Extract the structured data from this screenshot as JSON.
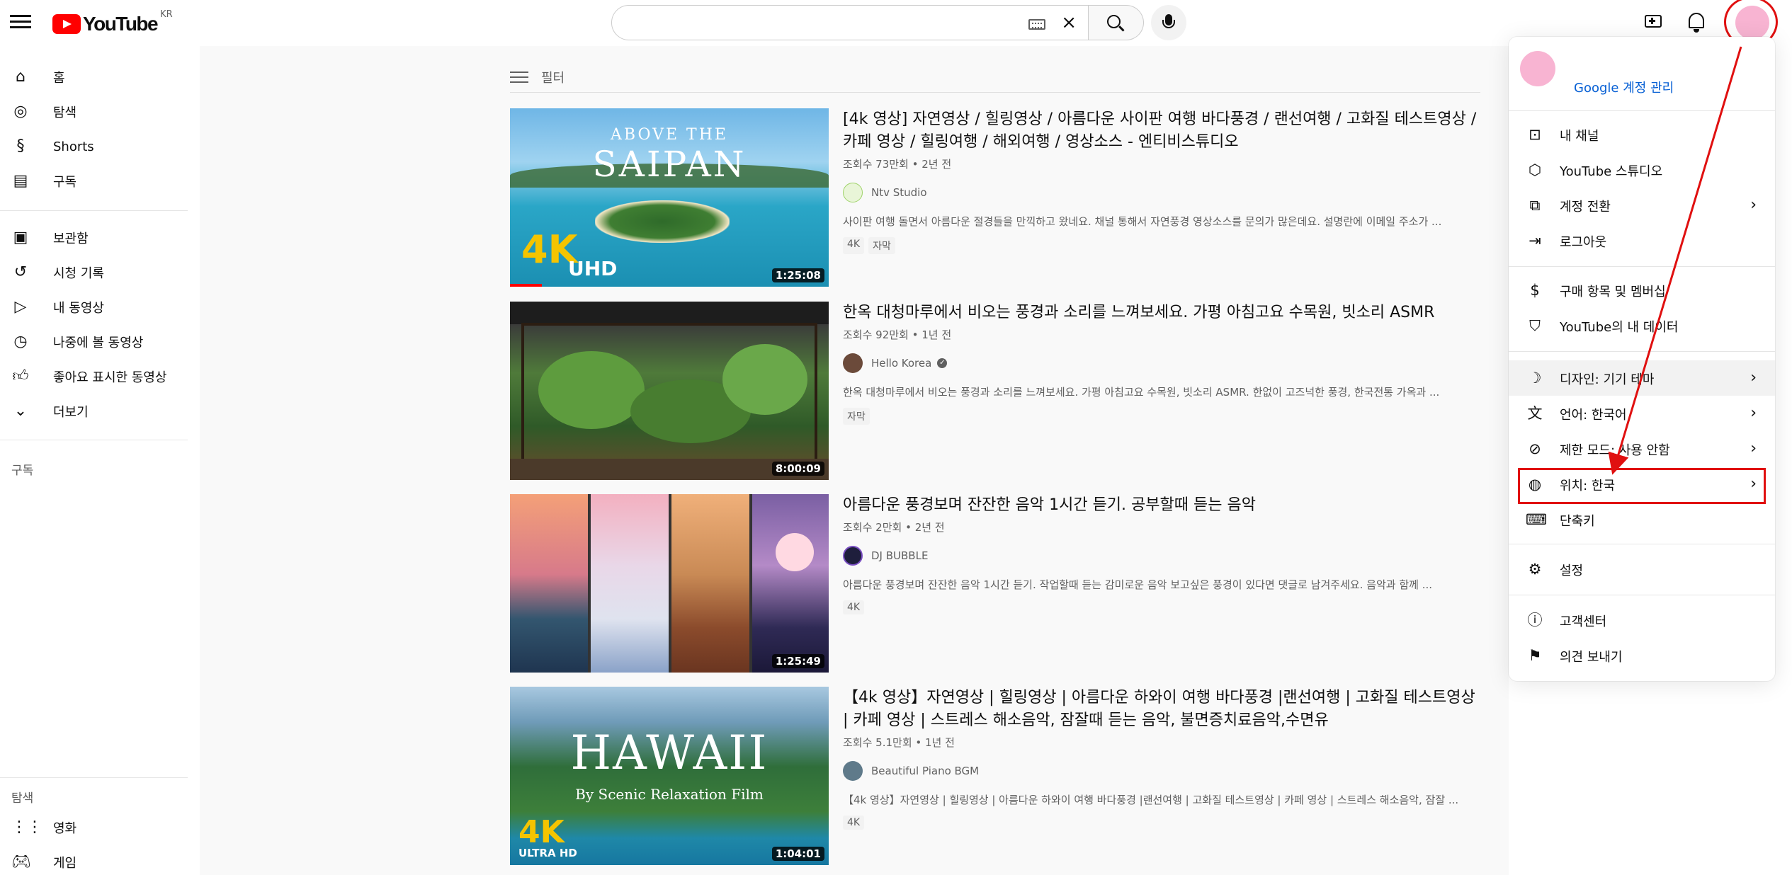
{
  "header": {
    "logo_text": "YouTube",
    "region": "KR",
    "search_value": "",
    "search_placeholder": ""
  },
  "sidebar": {
    "main": [
      {
        "label": "홈",
        "icon": "home-icon"
      },
      {
        "label": "탐색",
        "icon": "compass-icon"
      },
      {
        "label": "Shorts",
        "icon": "shorts-icon"
      },
      {
        "label": "구독",
        "icon": "subscriptions-icon"
      }
    ],
    "library": [
      {
        "label": "보관함",
        "icon": "library-icon"
      },
      {
        "label": "시청 기록",
        "icon": "history-icon"
      },
      {
        "label": "내 동영상",
        "icon": "my-videos-icon"
      },
      {
        "label": "나중에 볼 동영상",
        "icon": "watch-later-icon"
      },
      {
        "label": "좋아요 표시한 동영상",
        "icon": "thumbs-up-icon"
      },
      {
        "label": "더보기",
        "icon": "chevron-down-icon"
      }
    ],
    "subscriptions_title": "구독",
    "explore_title": "탐색",
    "explore": [
      {
        "label": "영화",
        "icon": "movies-icon"
      },
      {
        "label": "게임",
        "icon": "gaming-icon"
      }
    ]
  },
  "filter_label": "필터",
  "videos": [
    {
      "title": "[4k 영상] 자연영상 / 힐링영상 / 아름다운 사이판 여행 바다풍경 / 랜선여행 / 고화질 테스트영상 / 카페 영상 / 힐링여행 / 해외여행 / 영상소스 - 엔티비스튜디오",
      "meta": "조회수 73만회 • 2년 전",
      "channel": "Ntv Studio",
      "verified": false,
      "desc": "사이판 여행 돌면서 아름다운 절경들을 만끽하고 왔네요. 채널 통해서 자연풍경 영상소스를 문의가 많은데요. 설명란에 이메일 주소가 ...",
      "badges": [
        "4K",
        "자막"
      ],
      "duration": "1:25:08",
      "progress": 0.1,
      "thumb_text": {
        "above": "ABOVE THE",
        "big": "SAIPAN",
        "k4": "4K",
        "uhd": "UHD"
      }
    },
    {
      "title": "한옥 대청마루에서 비오는 풍경과 소리를 느껴보세요. 가평 아침고요 수목원, 빗소리 ASMR",
      "meta": "조회수 92만회 • 1년 전",
      "channel": "Hello Korea",
      "verified": true,
      "desc": "한옥 대청마루에서 비오는 풍경과 소리를 느껴보세요. 가평 아침고요 수목원, 빗소리 ASMR. 한없이 고즈넉한 풍경, 한국전통 가옥과 ...",
      "badges": [
        "자막"
      ],
      "duration": "8:00:09"
    },
    {
      "title": "아름다운 풍경보며 잔잔한 음악 1시간 듣기. 공부할때 듣는 음악",
      "meta": "조회수 2만회 • 2년 전",
      "channel": "DJ BUBBLE",
      "verified": false,
      "desc": "아름다운 풍경보며 잔잔한 음악 1시간 듣기. 작업할때 듣는 감미로운 음악 보고싶은 풍경이 있다면 댓글로 남겨주세요. 음악과 함께 ...",
      "badges": [
        "4K"
      ],
      "duration": "1:25:49"
    },
    {
      "title": "【4k 영상】자연영상 | 힐링영상 | 아름다운 하와이 여행 바다풍경 |랜선여행 | 고화질 테스트영상 | 카페 영상 | 스트레스 해소음악, 잠잘때 듣는 음악, 불면증치료음악,수면유",
      "meta": "조회수 5.1만회 • 1년 전",
      "channel": "Beautiful Piano BGM",
      "verified": false,
      "desc": "【4k 영상】자연영상 | 힐링영상 | 아름다운 하와이 여행 바다풍경 |랜선여행 | 고화질 테스트영상 | 카페 영상 | 스트레스 해소음악, 잠잘 ...",
      "badges": [
        "4K"
      ],
      "duration": "1:04:01",
      "thumb_text": {
        "haw": "HAWAII",
        "by": "By Scenic Relaxation Film",
        "k4": "4K",
        "ultra": "ULTRA HD"
      }
    }
  ],
  "menu": {
    "google_account": "Google 계정 관리",
    "items": [
      {
        "label": "내 채널",
        "icon": "my-channel-icon",
        "chevron": false
      },
      {
        "label": "YouTube 스튜디오",
        "icon": "studio-icon",
        "chevron": false
      },
      {
        "label": "계정 전환",
        "icon": "switch-account-icon",
        "chevron": true
      },
      {
        "label": "로그아웃",
        "icon": "sign-out-icon",
        "chevron": false
      },
      {
        "label": "구매 항목 및 멤버십",
        "icon": "dollar-icon",
        "chevron": false
      },
      {
        "label": "YouTube의 내 데이터",
        "icon": "shield-icon",
        "chevron": false
      },
      {
        "label": "디자인: 기기 테마",
        "icon": "moon-icon",
        "chevron": true
      },
      {
        "label": "언어: 한국어",
        "icon": "translate-icon",
        "chevron": true
      },
      {
        "label": "제한 모드: 사용 안함",
        "icon": "restricted-icon",
        "chevron": true
      },
      {
        "label": "위치: 한국",
        "icon": "globe-icon",
        "chevron": true
      },
      {
        "label": "단축키",
        "icon": "keyboard-icon",
        "chevron": false
      },
      {
        "label": "설정",
        "icon": "gear-icon",
        "chevron": false
      },
      {
        "label": "고객센터",
        "icon": "help-icon",
        "chevron": false
      },
      {
        "label": "의견 보내기",
        "icon": "feedback-icon",
        "chevron": false
      }
    ]
  },
  "colors": {
    "brand_red": "#ff0000",
    "annotation_red": "#e01010",
    "link_blue": "#065fd4",
    "avatar_pink": "#f8b4d2"
  }
}
